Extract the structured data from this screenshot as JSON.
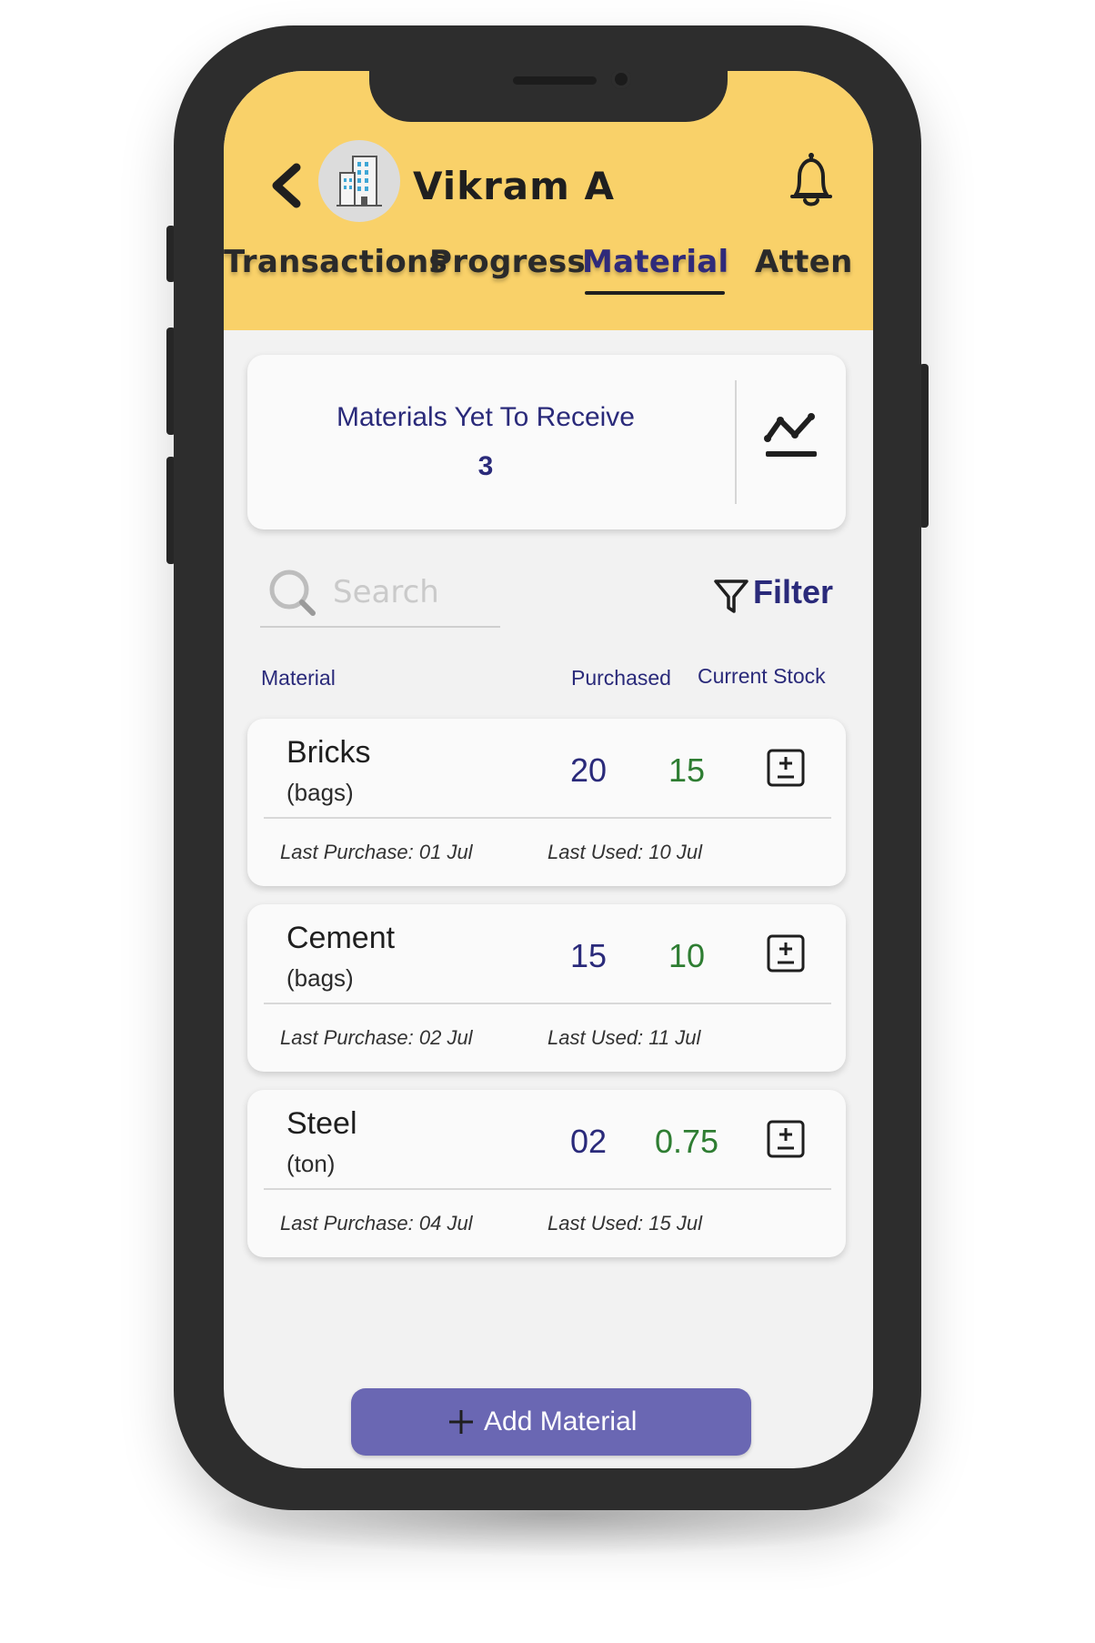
{
  "header": {
    "title": "Vikram A",
    "tabs": [
      {
        "label": "Transactions",
        "active": false
      },
      {
        "label": "Progress",
        "active": false
      },
      {
        "label": "Material",
        "active": true
      },
      {
        "label": "Atten",
        "active": false
      }
    ],
    "icons": {
      "back": "chevron-left-icon",
      "avatar": "building-icon",
      "notifications": "bell-icon"
    }
  },
  "summary": {
    "label": "Materials Yet To Receive",
    "count": "3",
    "icon": "trend-chart-icon"
  },
  "search": {
    "placeholder": "Search",
    "value": ""
  },
  "filter": {
    "label": "Filter",
    "icon": "funnel-icon"
  },
  "table": {
    "columns": {
      "material": "Material",
      "purchased": "Purchased",
      "stock": "Current Stock"
    },
    "rows": [
      {
        "name": "Bricks",
        "unit": "(bags)",
        "purchased": "20",
        "stock": "15",
        "last_purchase": "Last Purchase: 01 Jul",
        "last_used": "Last Used: 10 Jul"
      },
      {
        "name": "Cement",
        "unit": "(bags)",
        "purchased": "15",
        "stock": "10",
        "last_purchase": "Last Purchase: 02 Jul",
        "last_used": "Last Used: 11 Jul"
      },
      {
        "name": "Steel",
        "unit": "(ton)",
        "purchased": "02",
        "stock": "0.75",
        "last_purchase": "Last Purchase: 04 Jul",
        "last_used": "Last Used: 15 Jul"
      }
    ]
  },
  "actions": {
    "add_material": "Add Material"
  },
  "colors": {
    "header_bg": "#f9d169",
    "primary_text": "#2a2a7a",
    "stock_green": "#2e7d32",
    "button_bg": "#6a67b3",
    "screen_bg": "#f2f2f2"
  }
}
